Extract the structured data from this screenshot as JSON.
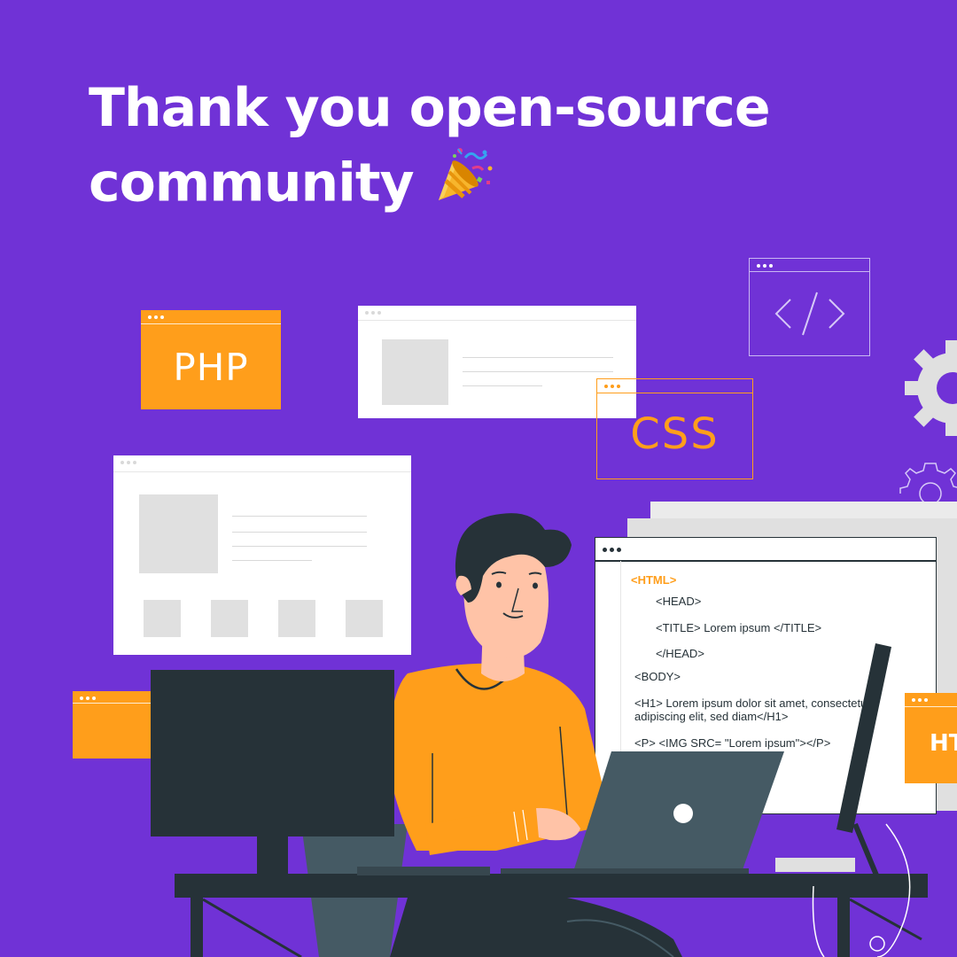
{
  "headline": {
    "line1": "Thank you open-source",
    "line2": "community",
    "emoji": "party-popper-icon"
  },
  "windows": {
    "php_label": "PHP",
    "css_label": "CSS",
    "html_tab_label": "HT"
  },
  "code_editor": {
    "lines": [
      "<HTML>",
      "<HEAD>",
      "<TITLE> Lorem ipsum </TITLE>",
      "</HEAD>",
      "<BODY>",
      "<H1> Lorem ipsum dolor sit amet, consectetuer",
      "adipiscing elit, sed diam</H1>",
      "<P> <IMG SRC= \"Lorem ipsum\"></P>"
    ]
  },
  "colors": {
    "background": "#7032d6",
    "accent_orange": "#ff9e1b",
    "dark": "#263238",
    "skin": "#ffc3a7"
  }
}
